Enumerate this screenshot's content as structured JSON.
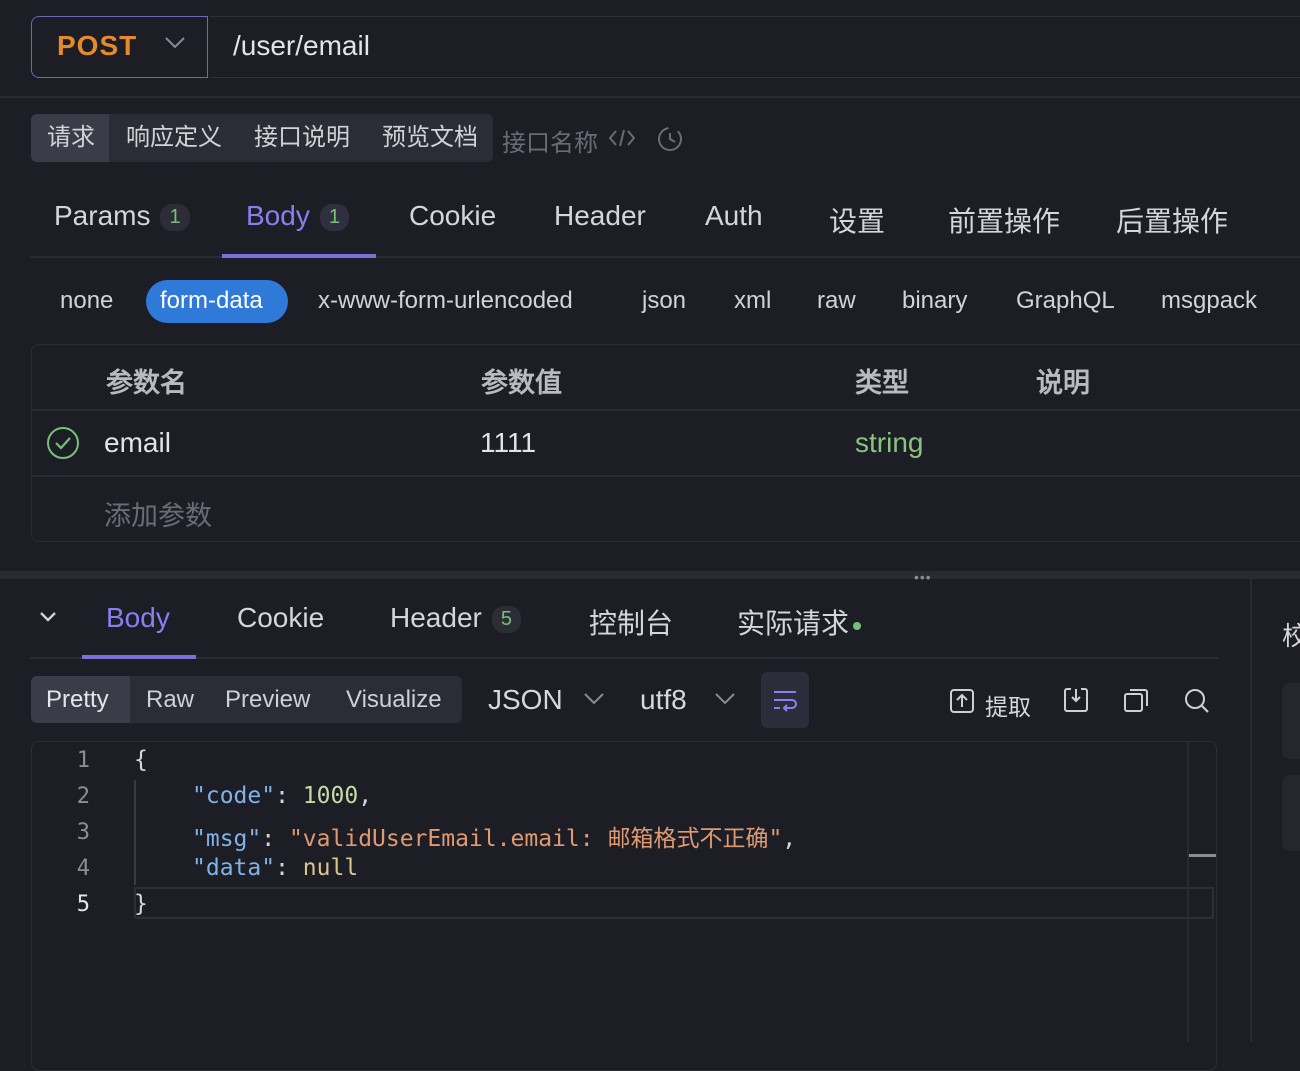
{
  "request": {
    "method": "POST",
    "url": "/user/email"
  },
  "segment_tabs": [
    "请求",
    "响应定义",
    "接口说明",
    "预览文档"
  ],
  "api_name_label": "接口名称",
  "main_tabs": [
    {
      "label": "Params",
      "badge": "1"
    },
    {
      "label": "Body",
      "badge": "1"
    },
    {
      "label": "Cookie"
    },
    {
      "label": "Header"
    },
    {
      "label": "Auth"
    },
    {
      "label": "设置"
    },
    {
      "label": "前置操作"
    },
    {
      "label": "后置操作"
    }
  ],
  "body_types": [
    "none",
    "form-data",
    "x-www-form-urlencoded",
    "json",
    "xml",
    "raw",
    "binary",
    "GraphQL",
    "msgpack"
  ],
  "params_table": {
    "headers": [
      "参数名",
      "参数值",
      "类型",
      "说明"
    ],
    "rows": [
      {
        "name": "email",
        "value": "1111",
        "type": "string",
        "enabled": true
      }
    ],
    "add_label": "添加参数"
  },
  "response": {
    "tabs": [
      {
        "label": "Body"
      },
      {
        "label": "Cookie"
      },
      {
        "label": "Header",
        "badge": "5"
      },
      {
        "label": "控制台"
      },
      {
        "label": "实际请求"
      }
    ],
    "view_modes": [
      "Pretty",
      "Raw",
      "Preview",
      "Visualize"
    ],
    "format": "JSON",
    "encoding": "utf8",
    "extract_label": "提取",
    "right_panel_label": "校",
    "line_numbers": [
      "1",
      "2",
      "3",
      "4",
      "5"
    ],
    "code": {
      "open": "{",
      "close": "}",
      "code_key": "\"code\"",
      "code_val": "1000",
      "msg_key": "\"msg\"",
      "msg_val": "\"validUserEmail.email: 邮箱格式不正确\"",
      "data_key": "\"data\"",
      "data_val": "null"
    }
  },
  "colors": {
    "accent": "#7c70d6",
    "method": "#e4892c",
    "pill": "#2f7ad9",
    "success": "#78c07a"
  }
}
